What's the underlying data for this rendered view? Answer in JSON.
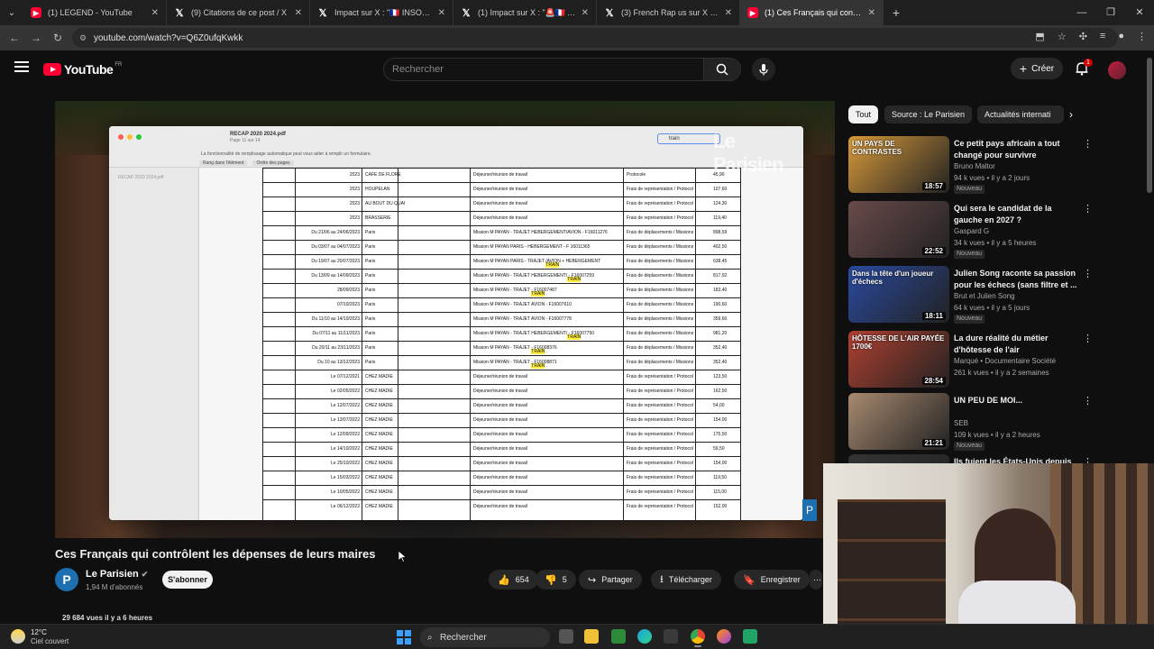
{
  "browser": {
    "tabs": [
      {
        "label": "(1) LEGEND - YouTube",
        "icon": "youtube-icon",
        "active": false
      },
      {
        "label": "(9) Citations de ce post / X",
        "icon": "x-icon",
        "active": false
      },
      {
        "label": "Impact sur X : \"🇫🇷 INSOLITE",
        "icon": "x-icon",
        "active": false
      },
      {
        "label": "(1) Impact sur X : \"🚨🇫🇷 ALERTE",
        "icon": "x-icon",
        "active": false
      },
      {
        "label": "(3) French Rap us sur X : \"@Fre",
        "icon": "x-icon",
        "active": false
      },
      {
        "label": "(1) Ces Français qui contrôlent",
        "icon": "youtube-icon",
        "active": true
      }
    ],
    "url": "youtube.com/watch?v=Q6Z0ufqKwkk"
  },
  "header": {
    "logo": "YouTube",
    "logo_region": "FR",
    "search_placeholder": "Rechercher",
    "create_label": "Créer",
    "notif_count": "1"
  },
  "video": {
    "title": "Ces Français qui contrôlent les dépenses de leurs maires",
    "channel": "Le Parisien",
    "channel_initial": "P",
    "subscribers": "1,94 M d'abonnés",
    "subscribe_label": "S'abonner",
    "likes": "654",
    "dislikes": "5",
    "share_label": "Partager",
    "download_label": "Télécharger",
    "save_label": "Enregistrer",
    "meta": "29 684 vues  il y a 6 heures",
    "watermark": "Le Parisien",
    "doc": {
      "title": "RECAP 2020 2024.pdf",
      "subtitle": "Page 11 sur 14",
      "note": "La fonctionnalité de remplissage automatique peut vous aider à remplir un formulaire.",
      "tabs": [
        "Rang dans l'élément",
        "Ordre des pages"
      ],
      "search": "train",
      "rows": [
        {
          "date": "2023",
          "place": "CAFE DE FLORE",
          "desc": "Déjeuner/réunion de travail",
          "cat": "Protocole",
          "amount": "45,90"
        },
        {
          "date": "2023",
          "place": "HOUPELAN",
          "desc": "Déjeuner/réunion de travail",
          "cat": "Frais de représentation / Protocole",
          "amount": "107,60"
        },
        {
          "date": "2023",
          "place": "AU BOUT DU QUAI",
          "desc": "Déjeuner/réunion de travail",
          "cat": "Frais de représentation / Protocole",
          "amount": "124,30"
        },
        {
          "date": "2023",
          "place": "BRASSERIE",
          "desc": "Déjeuner/réunion de travail",
          "cat": "Frais de représentation / Protocole",
          "amount": "119,40"
        },
        {
          "date": "Du 21/06 au 24/06/2023",
          "place": "Paris",
          "desc": "Mission M PAYAN - TRAJET HEBERGEMENT/AVION - F16011276",
          "cat": "Frais de déplacements / Missions",
          "amount": "898,59"
        },
        {
          "date": "Du 03/07 au 04/07/2023",
          "place": "Paris",
          "desc": "Mission M PAYAN PARIS - HEBERGEMENT - F 16011365",
          "cat": "Frais de déplacements / Missions",
          "amount": "402,50"
        },
        {
          "date": "Du 19/07 au 20/07/2023",
          "place": "Paris",
          "desc": "Mission M PAYAN PARIS - TRAJET TRAIN /AVION + HEBERGEMENT",
          "cat": "Frais de déplacements / Missions",
          "amount": "638,45"
        },
        {
          "date": "Du 13/09 au 14/09/2023",
          "place": "Paris",
          "desc": "Mission M PAYAN - TRAJET HEBERGEMENT/TRAIN - F16007259",
          "cat": "Frais de déplacements / Missions",
          "amount": "817,92"
        },
        {
          "date": "28/09/2023",
          "place": "Paris",
          "desc": "Mission M PAYAN - TRAJET TRAIN - F16007487",
          "cat": "Frais de déplacements / Missions",
          "amount": "183,40"
        },
        {
          "date": "07/10/2023",
          "place": "Paris",
          "desc": "Mission M PAYAN - TRAJET AVION - F16007610",
          "cat": "Frais de déplacements / Missions",
          "amount": "190,60"
        },
        {
          "date": "Du 11/10 au 14/10/2023",
          "place": "Paris",
          "desc": "Mission M PAYAN - TRAJET AVION - F16007778",
          "cat": "Frais de déplacements / Missions",
          "amount": "359,60"
        },
        {
          "date": "Du 07/11 au 11/11/2023",
          "place": "Paris",
          "desc": "Mission M PAYAN - TRAJET HEBERGEMENT/TRAIN - F16007750",
          "cat": "Frais de déplacements / Missions",
          "amount": "981,20"
        },
        {
          "date": "Du 20/11 au 23/11/2023",
          "place": "Paris",
          "desc": "Mission M PAYAN - TRAJET TRAIN - F16008376",
          "cat": "Frais de déplacements / Missions",
          "amount": "352,40"
        },
        {
          "date": "Du 10 au 13/12/2023",
          "place": "Paris",
          "desc": "Mission M PAYAN - TRAJET TRAIN - F16008871",
          "cat": "Frais de déplacements / Missions",
          "amount": "352,40"
        },
        {
          "date": "Le 07/12/2021",
          "place": "CHEZ MADIE",
          "desc": "Déjeuner/réunion de travail",
          "cat": "Frais de représentation / Protocole",
          "amount": "123,50"
        },
        {
          "date": "Le 02/05/2022",
          "place": "CHEZ MADIE",
          "desc": "Déjeuner/réunion de travail",
          "cat": "Frais de représentation / Protocole",
          "amount": "162,50"
        },
        {
          "date": "Le 12/07/2022",
          "place": "CHEZ MADIE",
          "desc": "Déjeuner/réunion de travail",
          "cat": "Frais de représentation / Protocole",
          "amount": "54,00"
        },
        {
          "date": "Le 13/07/2022",
          "place": "CHEZ MADIE",
          "desc": "Déjeuner/réunion de travail",
          "cat": "Frais de représentation / Protocole",
          "amount": "154,00"
        },
        {
          "date": "Le 12/09/2022",
          "place": "CHEZ MADIE",
          "desc": "Déjeuner/réunion de travail",
          "cat": "Frais de représentation / Protocole",
          "amount": "175,50"
        },
        {
          "date": "Le 14/10/2022",
          "place": "CHEZ MADIE",
          "desc": "Déjeuner/réunion de travail",
          "cat": "Frais de représentation / Protocole",
          "amount": "59,50"
        },
        {
          "date": "Le 25/10/2022",
          "place": "CHEZ MADIE",
          "desc": "Déjeuner/réunion de travail",
          "cat": "Frais de représentation / Protocole",
          "amount": "154,00"
        },
        {
          "date": "Le 15/03/2022",
          "place": "CHEZ MADIE",
          "desc": "Déjeuner/réunion de travail",
          "cat": "Frais de représentation / Protocole",
          "amount": "119,50"
        },
        {
          "date": "Le 10/05/2022",
          "place": "CHEZ MADIE",
          "desc": "Déjeuner/réunion de travail",
          "cat": "Frais de représentation / Protocole",
          "amount": "115,00"
        },
        {
          "date": "Le 06/12/2022",
          "place": "CHEZ MADIE",
          "desc": "Déjeuner/réunion de travail",
          "cat": "Frais de représentation / Protocole",
          "amount": "152,00"
        }
      ]
    }
  },
  "chips": [
    "Tout",
    "Source : Le Parisien",
    "Actualités internati"
  ],
  "recommendations": [
    {
      "title": "Ce petit pays africain a tout changé pour survivre",
      "channel": "Bruno Maltor",
      "views": "94 k vues • il y a 2 jours",
      "badge": "Nouveau",
      "duration": "18:57",
      "thumb_text": "UN PAYS DE CONTRASTES",
      "thumb_color": "#d89a3a"
    },
    {
      "title": "Qui sera le candidat de la gauche en 2027 ?",
      "channel": "Gaspard G",
      "views": "34 k vues • il y a 5 heures",
      "badge": "Nouveau",
      "duration": "22:52",
      "thumb_text": "",
      "thumb_color": "#6a4a4a"
    },
    {
      "title": "Julien Song raconte sa passion pour les échecs (sans filtre et ...",
      "channel": "Brut et Julien Song",
      "views": "64 k vues • il y a 5 jours",
      "badge": "Nouveau",
      "duration": "18:11",
      "thumb_text": "Dans la tête d'un joueur d'échecs",
      "thumb_color": "#2a4aa0"
    },
    {
      "title": "La dure réalité du métier d'hôtesse de l'air",
      "channel": "Marqué • Documentaire Société",
      "views": "261 k vues • il y a 2 semaines",
      "badge": "",
      "duration": "28:54",
      "thumb_text": "HÔTESSE DE L'AIR PAYÉE 1700€",
      "thumb_color": "#b04030"
    },
    {
      "title": "UN PEU DE MOI...",
      "channel": "SEB",
      "views": "109 k vues • il y a 2 heures",
      "badge": "Nouveau",
      "duration": "21:21",
      "thumb_text": "",
      "thumb_color": "#a88a70"
    },
    {
      "title": "Ils fuient les États-Unis depuis",
      "channel": "",
      "views": "",
      "badge": "",
      "duration": "",
      "thumb_text": "",
      "thumb_color": "#333333"
    }
  ],
  "taskbar": {
    "temp": "12°C",
    "weather": "Ciel couvert",
    "search": "Rechercher"
  }
}
